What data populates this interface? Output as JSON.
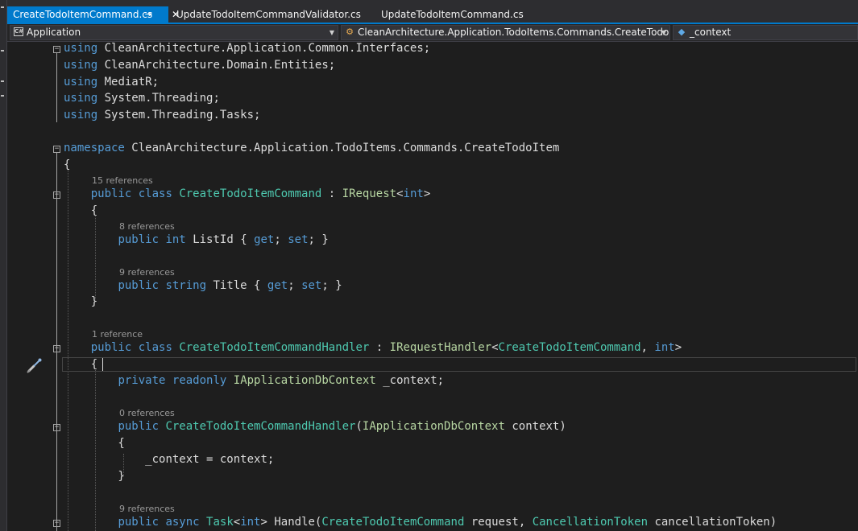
{
  "tabs": [
    {
      "label": "CreateTodoItemCommand.cs",
      "active": true,
      "pin_icon": "pin-icon",
      "close_icon": "close-icon"
    },
    {
      "label": "UpdateTodoItemCommandValidator.cs",
      "active": false
    },
    {
      "label": "UpdateTodoItemCommand.cs",
      "active": false
    }
  ],
  "pin_glyph": "⇥",
  "close_glyph": "✕",
  "navbar": {
    "project": "Application",
    "type": "CleanArchitecture.Application.TodoItems.Commands.CreateTodoItem.",
    "member": "_context",
    "project_icon": "csharp-project-icon",
    "type_icon": "class-icon",
    "member_icon": "field-icon"
  },
  "code": {
    "l1": "CleanArchitecture.Application.Common.Interfaces;",
    "l2": "CleanArchitecture.Domain.Entities;",
    "l3": "MediatR;",
    "l4": "System.Threading;",
    "l5": "System.Threading.Tasks;",
    "using_kw": "using",
    "namespace_kw": "namespace",
    "namespace_name": "CleanArchitecture.Application.TodoItems.Commands.CreateTodoItem",
    "public_kw": "public",
    "class_kw": "class",
    "int_kw": "int",
    "string_kw": "string",
    "get_kw": "get",
    "set_kw": "set",
    "private_kw": "private",
    "readonly_kw": "readonly",
    "async_kw": "async",
    "cmd_class": "CreateTodoItemCommand",
    "irequest": "IRequest",
    "handler_class": "CreateTodoItemCommandHandler",
    "irequest_handler": "IRequestHandler",
    "iappdb": "IApplicationDbContext",
    "task": "Task",
    "ct_type": "CancellationToken",
    "listid": "ListId",
    "title": "Title",
    "field": "_context;",
    "ctor_param": "context)",
    "assign": "_context = context;",
    "handle": "Handle(",
    "request_param": "request,",
    "ct_param": "cancellationToken)"
  },
  "lenses": {
    "cmd": "15 references",
    "listid": "8 references",
    "title": "9 references",
    "handler": "1 reference",
    "ctor": "0 references",
    "handle": "9 references"
  },
  "colors": {
    "keyword": "#569cd6",
    "type": "#4ec9b0",
    "interface": "#b8d7a3",
    "text": "#dcdcdc",
    "codelens": "#999999",
    "accent": "#007acc"
  },
  "gutter_icon": "screwdriver-icon"
}
